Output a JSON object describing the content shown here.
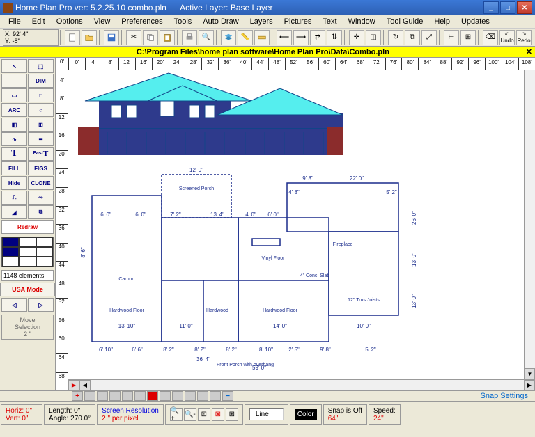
{
  "title": "Home Plan Pro ver: 5.2.25.10    combo.pln",
  "active_layer": "Active Layer: Base Layer",
  "menu": [
    "File",
    "Edit",
    "Options",
    "View",
    "Preferences",
    "Tools",
    "Auto Draw",
    "Layers",
    "Pictures",
    "Text",
    "Window",
    "Tool Guide",
    "Help",
    "Updates"
  ],
  "coords": {
    "x": "X: 92' 4\"",
    "y": "Y: -8\""
  },
  "path": "C:\\Program Files\\home plan software\\Home Plan Pro\\Data\\Combo.pln",
  "ruler_h": [
    "0'",
    "4'",
    "8'",
    "12'",
    "16'",
    "20'",
    "24'",
    "28'",
    "32'",
    "36'",
    "40'",
    "44'",
    "48'",
    "52'",
    "56'",
    "60'",
    "64'",
    "68'",
    "72'",
    "76'",
    "80'",
    "84'",
    "88'",
    "92'",
    "96'",
    "100'",
    "104'",
    "108'"
  ],
  "ruler_v": [
    "0'",
    "4'",
    "8'",
    "12'",
    "16'",
    "20'",
    "24'",
    "28'",
    "32'",
    "36'",
    "40'",
    "44'",
    "48'",
    "52'",
    "56'",
    "60'",
    "64'",
    "68'"
  ],
  "toolbar": {
    "undo_label": "Undo",
    "redo_label": "Redo"
  },
  "tools": {
    "dim": "DIM",
    "arc": "ARC",
    "text": "T",
    "fast": "Fast",
    "fasttext": "T",
    "fill": "FILL",
    "figs": "FIGS",
    "hide": "Hide",
    "clone": "CLONE",
    "redraw": "Redraw",
    "usa": "USA Mode",
    "move": "Move\nSelection\n2 \""
  },
  "element_count": "1148 elements",
  "zoomstrip": {
    "snap": "Snap Settings"
  },
  "status": {
    "horiz": "Horiz: 0\"",
    "vert": "Vert: 0\"",
    "length": "Length:  0\"",
    "angle": "Angle: 270.0°",
    "sres": "Screen Resolution",
    "spp": "2 \" per pixel",
    "line": "Line",
    "color": "Color",
    "snapoff": "Snap is Off",
    "snapval": "64\"",
    "speed": "Speed:",
    "speedval": "24\""
  },
  "plan_dims": {
    "top": [
      "12' 0\"",
      "9' 8\"",
      "22' 0\"",
      "4' 8\"",
      "5' 2\""
    ],
    "mid": [
      "6' 0\"",
      "6' 0\"",
      "7' 2\"",
      "13' 4\"",
      "4' 0\"",
      "6' 0\""
    ],
    "bottom1": [
      "13' 10\"",
      "11' 0\"",
      "14' 0\"",
      "10' 0\""
    ],
    "bottom2": [
      "6' 10\"",
      "6' 6\"",
      "8' 2\"",
      "8' 2\"",
      "8' 2\"",
      "8' 10\"",
      "2' 5\"",
      "9' 8\"",
      "5' 2\""
    ],
    "overall": [
      "36' 4\"",
      "59' 0\""
    ],
    "rooms": [
      "Screened Porch",
      "Carport",
      "Vinyl Floor",
      "4\" Conc. Slab",
      "Hardwood Floor",
      "Hardwood",
      "Hardwood Floor",
      "12\" Trus Joists",
      "Fireplace",
      "Front Porch with overhang"
    ],
    "vertical": [
      "26' 0\"",
      "13' 0\"",
      "13' 0\"",
      "8' 6\""
    ]
  }
}
